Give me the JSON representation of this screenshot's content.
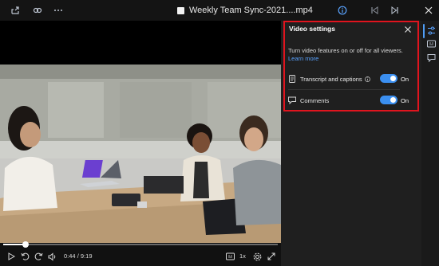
{
  "window": {
    "title": "Weekly Team Sync-2021....mp4"
  },
  "toolbar": {
    "share_icon": "share-icon",
    "link_icon": "link-icon",
    "more_icon": "more-icon",
    "info_icon": "info-icon",
    "prev_icon": "skip-previous-icon",
    "next_icon": "skip-next-icon",
    "close_icon": "close-icon"
  },
  "panel": {
    "title": "Video settings",
    "description": "Turn video features on or off for all viewers.",
    "learn_more": "Learn more",
    "settings": [
      {
        "label": "Transcript and captions",
        "state": "On",
        "enabled": true
      },
      {
        "label": "Comments",
        "state": "On",
        "enabled": true
      }
    ]
  },
  "player": {
    "current_time": "0:44",
    "separator": "/",
    "duration": "9:19",
    "progress": 0.08,
    "speed": "1x"
  },
  "colors": {
    "accent": "#3b8ff0",
    "highlight_border": "#e0141e",
    "link": "#5aa3ff"
  }
}
